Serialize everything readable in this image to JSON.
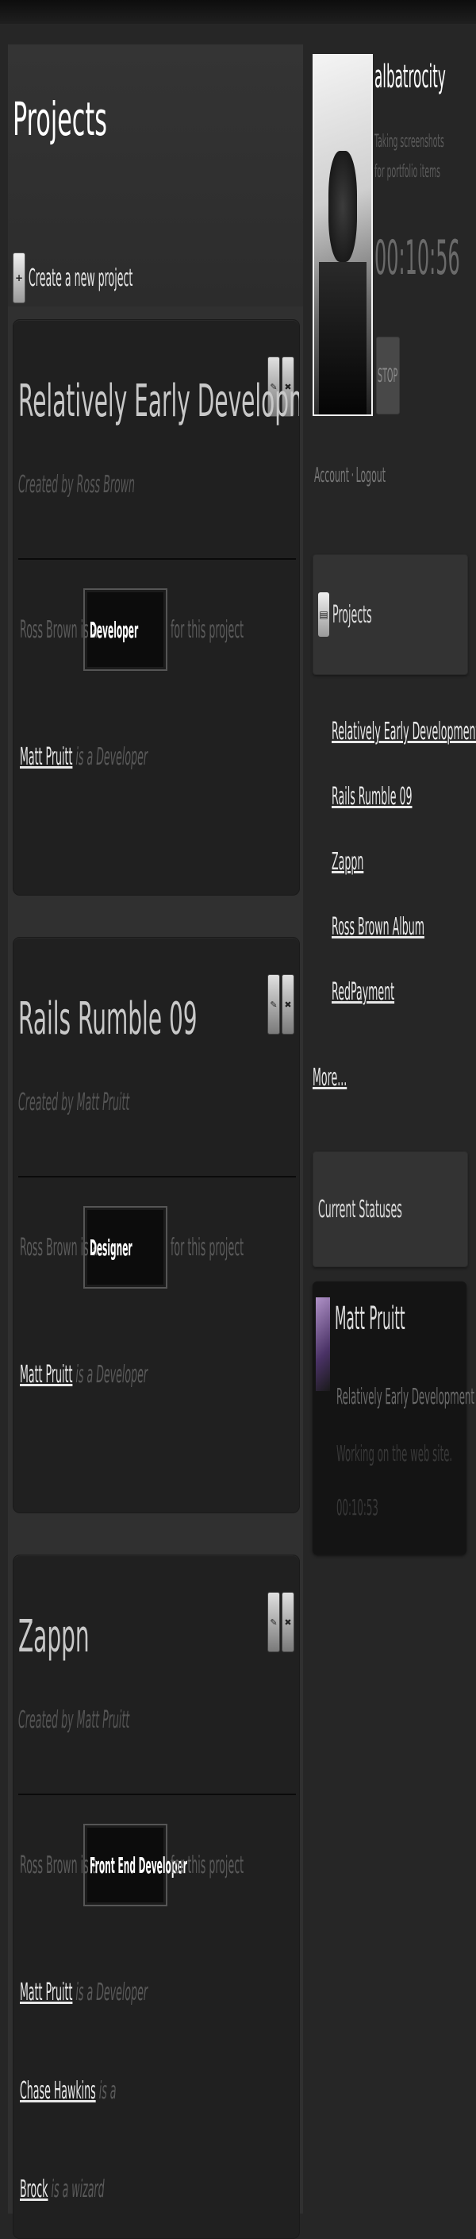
{
  "page": {
    "title": "Projects",
    "new_project_label": "Create a new project",
    "add_icon": "plus-icon"
  },
  "projects": [
    {
      "title": "Relatively Early Development",
      "creator": "Created by Ross Brown",
      "role_prefix": "Ross Brown is a",
      "role": "Developer",
      "role_suffix": "for this project",
      "members": [
        {
          "name": "Matt Pruitt",
          "desc": "is a Developer"
        }
      ]
    },
    {
      "title": "Rails Rumble 09",
      "creator": "Created by Matt Pruitt",
      "role_prefix": "Ross Brown is a",
      "role": "Designer",
      "role_suffix": "for this project",
      "members": [
        {
          "name": "Matt Pruitt",
          "desc": "is a Developer"
        }
      ]
    },
    {
      "title": "Zappn",
      "creator": "Created by Matt Pruitt",
      "role_prefix": "Ross Brown is a",
      "role": "Front End Developer",
      "role_suffix": "for this project",
      "members": [
        {
          "name": "Matt Pruitt",
          "desc": "is a Developer"
        },
        {
          "name": "Chase Hawkins",
          "desc": "is a"
        },
        {
          "name": "Brock",
          "desc": "is a wizard"
        }
      ]
    }
  ],
  "sidebar": {
    "username": "albatrocity",
    "status": "Taking screenshots for portfolio items",
    "timer": "00:10:56",
    "stop_label": "STOP",
    "account_label": "Account",
    "logout_label": "Logout",
    "projects_heading": "Projects",
    "project_links": [
      "Relatively Early Development",
      "Rails Rumble 09",
      "Zappn",
      "Ross Brown Album",
      "RedPayment"
    ],
    "more_label": "More...",
    "statuses_heading": "Current Statuses",
    "current_status": {
      "name": "Matt Pruitt",
      "project": "Relatively Early Development",
      "message": "Working on the web site.",
      "time": "00:10:53"
    }
  }
}
